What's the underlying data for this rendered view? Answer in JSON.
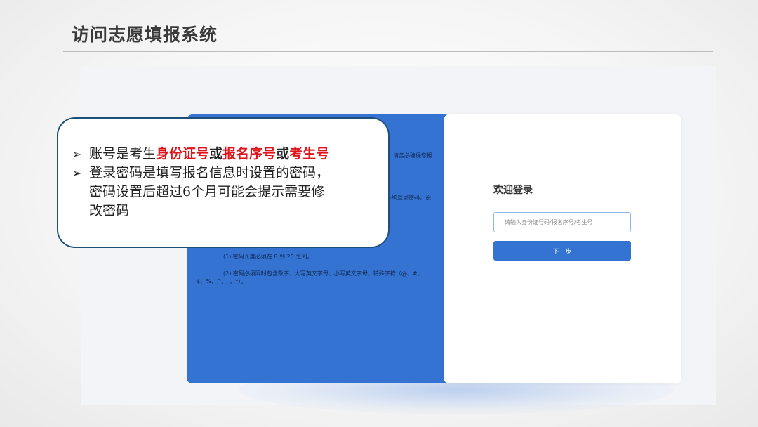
{
  "slide": {
    "title": "访问志愿填报系统"
  },
  "blue_panel": {
    "fragment_1": "请务必确保您报",
    "fragment_2": "系统登录密码，设",
    "rule_1": "(1) 密码长度必须在 8 到 20 之间。",
    "rule_2": "(2) 密码必须同时包含数字、大写英文字母、小写英文字母、特殊字符（@、#、",
    "rule_2_cont": "$、%、^、_、*）。"
  },
  "login": {
    "title": "欢迎登录",
    "input_placeholder": "请输入身份证号码/报名序号/考生号",
    "next_label": "下一步"
  },
  "callout": {
    "bullet_marker": "➢",
    "bullet_1_prefix": "账号是考生",
    "bullet_1_id": "身份证号",
    "bullet_1_or_a": "或",
    "bullet_1_regno": "报名序号",
    "bullet_1_or_b": "或",
    "bullet_1_exam": "考生号",
    "bullet_2_line1": "登录密码是填写报名信息时设置的密码，",
    "bullet_2_line2": "密码设置后超过6个月可能会提示需要修",
    "bullet_2_line3": "改密码"
  },
  "colors": {
    "accent_blue": "#3473d1",
    "highlight_red": "#e0141a",
    "callout_border": "#1e4e7c"
  }
}
